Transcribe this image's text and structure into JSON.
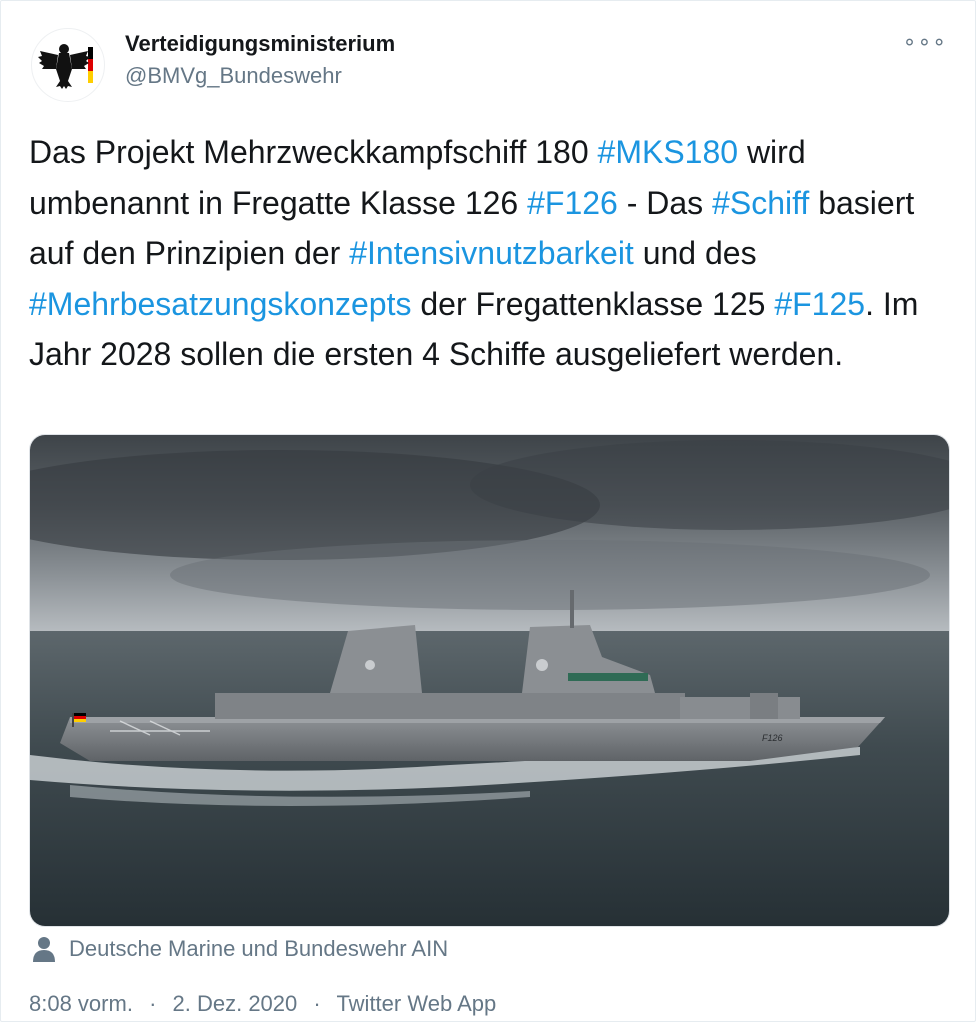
{
  "account": {
    "display_name": "Verteidigungsministerium",
    "handle": "@BMVg_Bundeswehr",
    "avatar_icon": "federal-eagle-icon"
  },
  "more_menu": {
    "label": "∘∘∘",
    "icon": "more-options-icon"
  },
  "tweet": {
    "segments": [
      {
        "text": "Das Projekt Mehrzweckkampfschiff 180 ",
        "type": "text"
      },
      {
        "text": "#MKS180",
        "type": "hashtag"
      },
      {
        "text": " wird umbenannt in Fregatte Klasse 126 ",
        "type": "text"
      },
      {
        "text": "#F126",
        "type": "hashtag"
      },
      {
        "text": " - Das ",
        "type": "text"
      },
      {
        "text": "#Schiff",
        "type": "hashtag"
      },
      {
        "text": " basiert auf den  Prinzipien der ",
        "type": "text"
      },
      {
        "text": "#Intensivnutzbarkeit",
        "type": "hashtag"
      },
      {
        "text": " und des ",
        "type": "text"
      },
      {
        "text": "#Mehrbesatzungskonzepts",
        "type": "hashtag"
      },
      {
        "text": " der Fregattenklasse 125 ",
        "type": "text"
      },
      {
        "text": "#F125",
        "type": "hashtag"
      },
      {
        "text": ". Im Jahr 2028 sollen die ersten 4 Schiffe ausgeliefert werden.",
        "type": "text"
      }
    ]
  },
  "media": {
    "hull_marking": "F126"
  },
  "photo_credit": {
    "icon": "person-icon",
    "text": "Deutsche Marine und Bundeswehr AIN"
  },
  "footer": {
    "time": "8:08 vorm.",
    "date": "2. Dez. 2020",
    "source": "Twitter Web App",
    "separator": "·"
  },
  "colors": {
    "hashtag": "#1b95e0",
    "text": "#14171a",
    "secondary": "#657786"
  }
}
